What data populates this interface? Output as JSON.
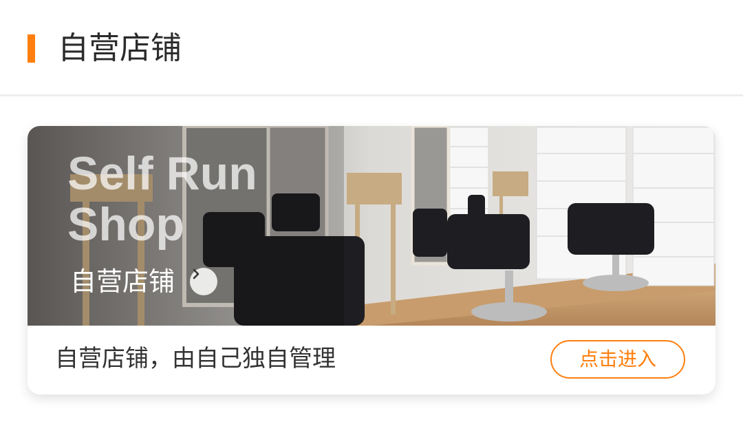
{
  "header": {
    "title": "自营店铺",
    "accent_color": "#ff7f0e"
  },
  "card": {
    "banner": {
      "english_title": "Self Run Shop",
      "chinese_title": "自营店铺",
      "arrow_icon": "chevron-right-icon",
      "photo_subject": "salon-interior-photo"
    },
    "description": "自营店铺，由自己独自管理",
    "enter_button": "点击进入"
  }
}
